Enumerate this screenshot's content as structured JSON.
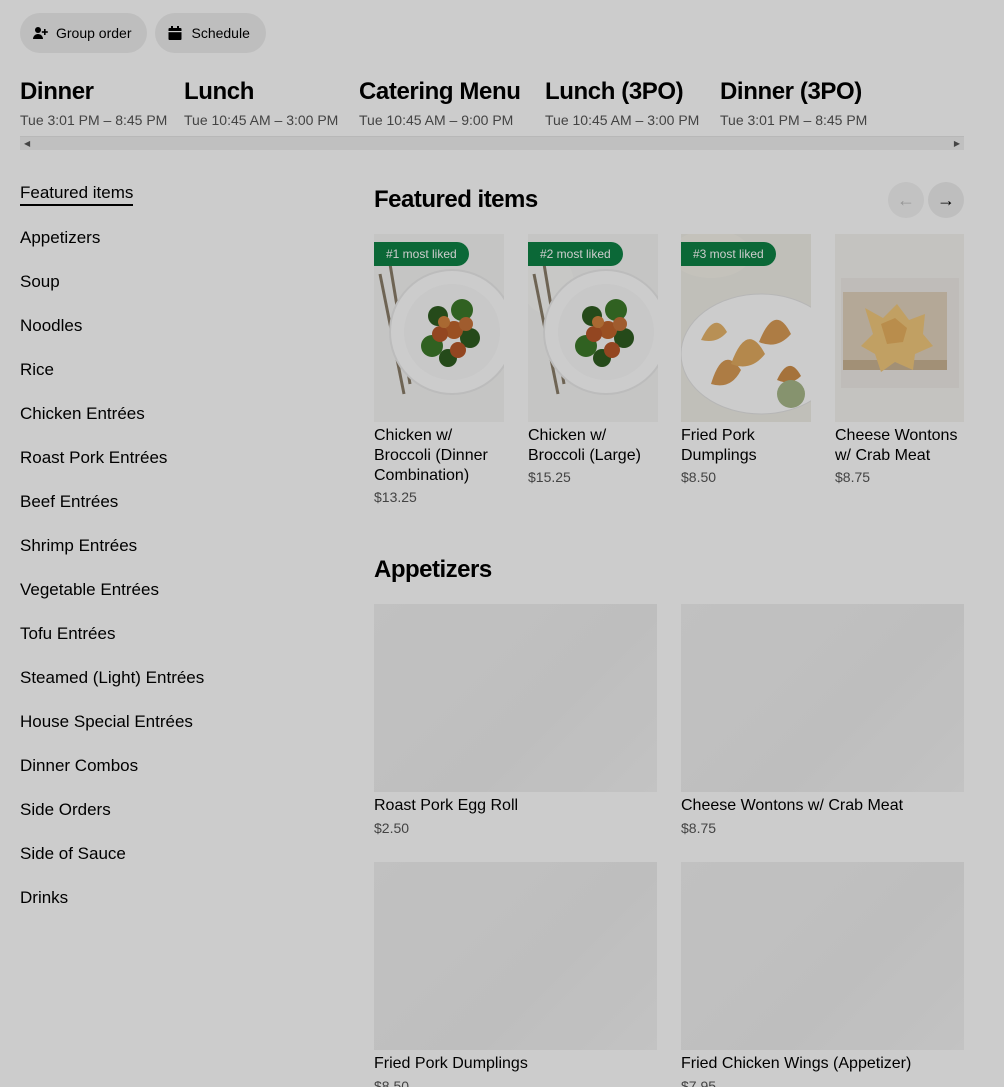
{
  "top_actions": {
    "group_order_label": "Group order",
    "schedule_label": "Schedule"
  },
  "menus": [
    {
      "title": "Dinner",
      "hours": "Tue 3:01 PM – 8:45 PM",
      "active": true
    },
    {
      "title": "Lunch",
      "hours": "Tue 10:45 AM – 3:00 PM"
    },
    {
      "title": "Catering Menu",
      "hours": "Tue 10:45 AM – 9:00 PM"
    },
    {
      "title": "Lunch (3PO)",
      "hours": "Tue 10:45 AM – 3:00 PM"
    },
    {
      "title": "Dinner (3PO)",
      "hours": "Tue 3:01 PM – 8:45 PM"
    }
  ],
  "sidenav": [
    "Featured items",
    "Appetizers",
    "Soup",
    "Noodles",
    "Rice",
    "Chicken Entrées",
    "Roast Pork Entrées",
    "Beef Entrées",
    "Shrimp Entrées",
    "Vegetable Entrées",
    "Tofu Entrées",
    "Steamed (Light) Entrées",
    "House Special Entrées",
    "Dinner Combos",
    "Side Orders",
    "Side of Sauce",
    "Drinks"
  ],
  "featured": {
    "title": "Featured items",
    "items": [
      {
        "badge": "#1 most liked",
        "name": "Chicken w/ Broccoli (Dinner Combination)",
        "price": "$13.25"
      },
      {
        "badge": "#2 most liked",
        "name": "Chicken w/ Broccoli (Large)",
        "price": "$15.25"
      },
      {
        "badge": "#3 most liked",
        "name": "Fried Pork Dumplings",
        "price": "$8.50"
      },
      {
        "badge": "",
        "name": "Cheese Wontons w/ Crab Meat",
        "price": "$8.75"
      }
    ]
  },
  "appetizers": {
    "title": "Appetizers",
    "items": [
      {
        "name": "Roast Pork Egg Roll",
        "price": "$2.50"
      },
      {
        "name": "Cheese Wontons w/ Crab Meat",
        "price": "$8.75"
      },
      {
        "name": "Fried Pork Dumplings",
        "price": "$8.50"
      },
      {
        "name": "Fried Chicken Wings (Appetizer)",
        "price": "$7.95"
      }
    ]
  },
  "colors": {
    "badge_green": "#0e8345",
    "overlay": "rgba(0,0,0,0.2)"
  }
}
